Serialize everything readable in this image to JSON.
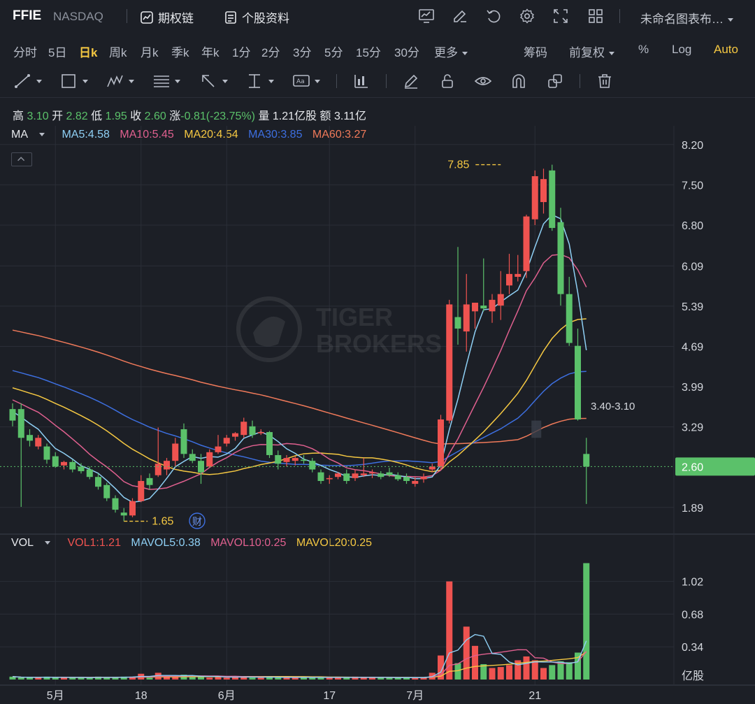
{
  "header": {
    "ticker": "FFIE",
    "exchange": "NASDAQ",
    "options_link": "期权链",
    "profile_link": "个股资料",
    "chart_name": "未命名图表布…"
  },
  "periods": [
    "分时",
    "5日",
    "日k",
    "周k",
    "月k",
    "季k",
    "年k",
    "1分",
    "2分",
    "3分",
    "5分",
    "15分",
    "30分",
    "更多"
  ],
  "active_period": "日k",
  "options": {
    "chips": "筹码",
    "adjust": "前复权",
    "percent": "%",
    "log": "Log",
    "auto": "Auto"
  },
  "quote": {
    "high_label": "高",
    "high": "3.10",
    "open_label": "开",
    "open": "2.82",
    "low_label": "低",
    "low": "1.95",
    "close_label": "收",
    "close": "2.60",
    "change_label": "涨",
    "change": "-0.81(-23.75%)",
    "volume_label": "量",
    "volume": "1.21亿股",
    "amount_label": "额",
    "amount": "3.11亿"
  },
  "ma_legend": {
    "label": "MA",
    "ma5": "MA5:4.58",
    "ma10": "MA10:5.45",
    "ma20": "MA20:4.54",
    "ma30": "MA30:3.85",
    "ma60": "MA60:3.27"
  },
  "vol_legend": {
    "label": "VOL",
    "vol1": "VOL1:1.21",
    "mavol5": "MAVOL5:0.38",
    "mavol10": "MAVOL10:0.25",
    "mavol20": "MAVOL20:0.25"
  },
  "colors": {
    "up": "#ef5350",
    "down": "#5bc16a",
    "ma5": "#8fd0f5",
    "ma10": "#e0608f",
    "ma20": "#f5c842",
    "ma30": "#3d6fe0",
    "ma60": "#f07a5a",
    "accent": "#f5c842"
  },
  "watermark": [
    "TIGER",
    "BROKERS"
  ],
  "chart_data": {
    "type": "candlestick",
    "price_axis": {
      "ticks": [
        "8.20",
        "7.50",
        "6.80",
        "6.09",
        "5.39",
        "4.69",
        "3.99",
        "3.29",
        "1.89"
      ],
      "ylim": [
        1.45,
        8.55
      ]
    },
    "volume_axis": {
      "ticks": [
        "1.02",
        "0.68",
        "0.34"
      ],
      "unit": "亿股",
      "ylim": [
        0,
        1.25
      ]
    },
    "x_ticks": [
      {
        "label": "5月",
        "index": 5
      },
      {
        "label": "18",
        "index": 15
      },
      {
        "label": "6月",
        "index": 25
      },
      {
        "label": "17",
        "index": 37
      },
      {
        "label": "7月",
        "index": 47
      },
      {
        "label": "21",
        "index": 61
      }
    ],
    "last_price": "2.60",
    "annotations": {
      "high": {
        "text": "7.85",
        "index": 57,
        "value": 7.85
      },
      "low": {
        "text": "1.65",
        "index": 13,
        "value": 1.65
      },
      "gap": {
        "text": "3.40-3.10",
        "index": 61
      },
      "earnings": "财"
    },
    "candles": [
      {
        "o": 3.6,
        "h": 3.7,
        "l": 3.3,
        "c": 3.4
      },
      {
        "o": 3.6,
        "h": 3.7,
        "l": 1.9,
        "c": 3.1
      },
      {
        "o": 3.15,
        "h": 3.25,
        "l": 2.95,
        "c": 3.05
      },
      {
        "o": 2.95,
        "h": 3.15,
        "l": 2.9,
        "c": 3.1
      },
      {
        "o": 2.95,
        "h": 3.0,
        "l": 2.65,
        "c": 2.72
      },
      {
        "o": 2.78,
        "h": 2.85,
        "l": 2.58,
        "c": 2.6
      },
      {
        "o": 2.62,
        "h": 2.7,
        "l": 2.55,
        "c": 2.68
      },
      {
        "o": 2.68,
        "h": 2.72,
        "l": 2.5,
        "c": 2.55
      },
      {
        "o": 2.6,
        "h": 2.66,
        "l": 2.48,
        "c": 2.52
      },
      {
        "o": 2.55,
        "h": 2.6,
        "l": 2.38,
        "c": 2.42
      },
      {
        "o": 2.42,
        "h": 2.48,
        "l": 2.2,
        "c": 2.25
      },
      {
        "o": 2.28,
        "h": 2.32,
        "l": 2.0,
        "c": 2.05
      },
      {
        "o": 2.05,
        "h": 2.1,
        "l": 1.8,
        "c": 1.85
      },
      {
        "o": 1.8,
        "h": 1.88,
        "l": 1.65,
        "c": 1.75
      },
      {
        "o": 1.75,
        "h": 2.05,
        "l": 1.72,
        "c": 2.0
      },
      {
        "o": 2.0,
        "h": 2.45,
        "l": 1.98,
        "c": 2.35
      },
      {
        "o": 2.4,
        "h": 2.48,
        "l": 2.2,
        "c": 2.28
      },
      {
        "o": 2.45,
        "h": 3.28,
        "l": 2.42,
        "c": 2.65
      },
      {
        "o": 2.55,
        "h": 2.75,
        "l": 2.45,
        "c": 2.7
      },
      {
        "o": 2.7,
        "h": 3.1,
        "l": 2.6,
        "c": 3.0
      },
      {
        "o": 3.25,
        "h": 3.35,
        "l": 2.75,
        "c": 2.82
      },
      {
        "o": 2.82,
        "h": 2.9,
        "l": 2.66,
        "c": 2.7
      },
      {
        "o": 2.7,
        "h": 2.82,
        "l": 2.3,
        "c": 2.5
      },
      {
        "o": 2.6,
        "h": 2.9,
        "l": 2.58,
        "c": 2.85
      },
      {
        "o": 2.85,
        "h": 3.15,
        "l": 2.82,
        "c": 2.95
      },
      {
        "o": 3.0,
        "h": 3.15,
        "l": 2.95,
        "c": 3.1
      },
      {
        "o": 3.12,
        "h": 3.2,
        "l": 3.05,
        "c": 3.18
      },
      {
        "o": 3.15,
        "h": 3.45,
        "l": 3.1,
        "c": 3.38
      },
      {
        "o": 3.3,
        "h": 3.4,
        "l": 3.1,
        "c": 3.15
      },
      {
        "o": 3.18,
        "h": 3.25,
        "l": 3.15,
        "c": 3.2
      },
      {
        "o": 3.2,
        "h": 3.22,
        "l": 2.75,
        "c": 2.8
      },
      {
        "o": 2.8,
        "h": 2.88,
        "l": 2.55,
        "c": 2.65
      },
      {
        "o": 2.68,
        "h": 2.8,
        "l": 2.6,
        "c": 2.75
      },
      {
        "o": 2.7,
        "h": 2.78,
        "l": 2.62,
        "c": 2.75
      },
      {
        "o": 2.72,
        "h": 2.8,
        "l": 2.65,
        "c": 2.7
      },
      {
        "o": 2.7,
        "h": 2.75,
        "l": 2.5,
        "c": 2.55
      },
      {
        "o": 2.5,
        "h": 2.55,
        "l": 2.3,
        "c": 2.35
      },
      {
        "o": 2.38,
        "h": 2.45,
        "l": 2.3,
        "c": 2.4
      },
      {
        "o": 2.42,
        "h": 2.5,
        "l": 2.38,
        "c": 2.48
      },
      {
        "o": 2.48,
        "h": 2.55,
        "l": 2.3,
        "c": 2.35
      },
      {
        "o": 2.4,
        "h": 2.55,
        "l": 2.35,
        "c": 2.48
      },
      {
        "o": 2.45,
        "h": 2.75,
        "l": 2.42,
        "c": 2.48
      },
      {
        "o": 2.48,
        "h": 2.55,
        "l": 2.4,
        "c": 2.5
      },
      {
        "o": 2.48,
        "h": 2.52,
        "l": 2.38,
        "c": 2.42
      },
      {
        "o": 2.5,
        "h": 2.58,
        "l": 2.42,
        "c": 2.45
      },
      {
        "o": 2.45,
        "h": 2.5,
        "l": 2.35,
        "c": 2.38
      },
      {
        "o": 2.42,
        "h": 2.48,
        "l": 2.3,
        "c": 2.35
      },
      {
        "o": 2.3,
        "h": 2.42,
        "l": 2.25,
        "c": 2.35
      },
      {
        "o": 2.38,
        "h": 2.48,
        "l": 2.32,
        "c": 2.42
      },
      {
        "o": 2.55,
        "h": 2.65,
        "l": 2.5,
        "c": 2.6
      },
      {
        "o": 2.6,
        "h": 3.5,
        "l": 2.55,
        "c": 3.42
      },
      {
        "o": 3.4,
        "h": 5.5,
        "l": 3.35,
        "c": 5.42
      },
      {
        "o": 5.2,
        "h": 6.42,
        "l": 4.72,
        "c": 5.0
      },
      {
        "o": 4.95,
        "h": 5.95,
        "l": 4.6,
        "c": 5.42
      },
      {
        "o": 5.3,
        "h": 5.45,
        "l": 5.0,
        "c": 5.45
      },
      {
        "o": 5.4,
        "h": 6.22,
        "l": 5.3,
        "c": 5.35
      },
      {
        "o": 5.3,
        "h": 5.6,
        "l": 5.1,
        "c": 5.5
      },
      {
        "o": 5.4,
        "h": 6.0,
        "l": 5.15,
        "c": 5.6
      },
      {
        "o": 5.75,
        "h": 6.3,
        "l": 5.6,
        "c": 5.95
      },
      {
        "o": 5.9,
        "h": 6.28,
        "l": 5.82,
        "c": 5.95
      },
      {
        "o": 6.0,
        "h": 6.98,
        "l": 5.88,
        "c": 6.95
      },
      {
        "o": 6.9,
        "h": 7.75,
        "l": 6.8,
        "c": 7.65
      },
      {
        "o": 7.2,
        "h": 7.78,
        "l": 7.0,
        "c": 7.6
      },
      {
        "o": 7.75,
        "h": 7.85,
        "l": 6.7,
        "c": 6.75
      },
      {
        "o": 6.85,
        "h": 7.1,
        "l": 5.4,
        "c": 5.6
      },
      {
        "o": 5.6,
        "h": 5.9,
        "l": 4.7,
        "c": 4.75
      },
      {
        "o": 4.7,
        "h": 5.0,
        "l": 3.4,
        "c": 3.42
      },
      {
        "o": 2.82,
        "h": 3.1,
        "l": 1.95,
        "c": 2.6
      }
    ],
    "volume": [
      0.03,
      0.02,
      0.02,
      0.02,
      0.03,
      0.02,
      0.02,
      0.02,
      0.02,
      0.02,
      0.03,
      0.02,
      0.02,
      0.03,
      0.03,
      0.06,
      0.02,
      0.07,
      0.03,
      0.03,
      0.05,
      0.03,
      0.03,
      0.02,
      0.03,
      0.02,
      0.03,
      0.03,
      0.02,
      0.02,
      0.03,
      0.02,
      0.02,
      0.02,
      0.02,
      0.03,
      0.02,
      0.02,
      0.02,
      0.02,
      0.03,
      0.02,
      0.02,
      0.02,
      0.02,
      0.02,
      0.02,
      0.02,
      0.02,
      0.07,
      0.25,
      1.02,
      0.17,
      0.55,
      0.35,
      0.16,
      0.12,
      0.13,
      0.15,
      0.2,
      0.24,
      0.2,
      0.12,
      0.15,
      0.19,
      0.18,
      0.28,
      1.21
    ],
    "series": {
      "ma5": {
        "last": 4.58
      },
      "ma10": {
        "last": 5.45
      },
      "ma20": {
        "last": 4.54
      },
      "ma30": {
        "last": 3.85
      },
      "ma60": {
        "last": 3.27
      }
    }
  }
}
